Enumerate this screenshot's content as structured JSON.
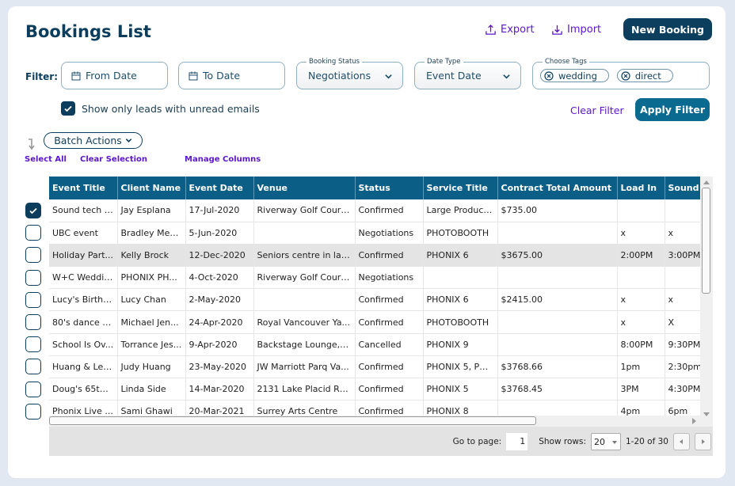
{
  "header": {
    "title": "Bookings List",
    "export_label": "Export",
    "import_label": "Import",
    "new_booking_label": "New Booking"
  },
  "filters": {
    "label": "Filter:",
    "from_date_placeholder": "From Date",
    "to_date_placeholder": "To Date",
    "booking_status": {
      "legend": "Booking Status",
      "value": "Negotiations"
    },
    "date_type": {
      "legend": "Date Type",
      "value": "Event Date"
    },
    "tags": {
      "legend": "Choose Tags",
      "selected": [
        "wedding",
        "direct"
      ]
    },
    "unread_checkbox": {
      "label": "Show only leads with unread emails",
      "checked": true
    },
    "clear_label": "Clear Filter",
    "apply_label": "Apply Filter"
  },
  "actions": {
    "batch_label": "Batch Actions",
    "select_all": "Select All",
    "clear_selection": "Clear Selection",
    "manage_columns": "Manage Columns"
  },
  "table": {
    "columns": [
      "Event Title",
      "Client Name",
      "Event Date",
      "Venue",
      "Status",
      "Service Title",
      "Contract Total Amount",
      "Load In",
      "Sound"
    ],
    "rows": [
      {
        "checked": true,
        "highlight": false,
        "cells": [
          "Sound tech -...",
          "Jay Esplana",
          "17-Jul-2020",
          "Riverway Golf Cours...",
          "Confirmed",
          "Large Product...",
          "$735.00",
          "",
          ""
        ]
      },
      {
        "checked": false,
        "highlight": false,
        "cells": [
          "UBC event",
          "Bradley Men...",
          "5-Jun-2020",
          "",
          "Negotiations",
          "PHOTOBOOTH",
          "",
          "x",
          "x"
        ]
      },
      {
        "checked": false,
        "highlight": true,
        "cells": [
          "Holiday Part...",
          "Kelly Brock",
          "12-Dec-2020",
          "Seniors centre in lan...",
          "Confirmed",
          "PHONIX 6",
          "$3675.00",
          "2:00PM",
          "3:00PM"
        ]
      },
      {
        "checked": false,
        "highlight": false,
        "cells": [
          "W+C Wedding",
          "PHONIX PH...",
          "4-Oct-2020",
          "Riverway Golf Cours...",
          "Negotiations",
          "",
          "",
          "",
          ""
        ]
      },
      {
        "checked": false,
        "highlight": false,
        "cells": [
          "Lucy's Birthd...",
          "Lucy Chan",
          "2-May-2020",
          "",
          "Confirmed",
          "PHONIX 6",
          "$2415.00",
          "x",
          "x"
        ]
      },
      {
        "checked": false,
        "highlight": false,
        "cells": [
          "80's dance p...",
          "Michael Jen...",
          "24-Apr-2020",
          "Royal Vancouver Ya...",
          "Confirmed",
          "PHOTOBOOTH",
          "",
          "x",
          "X"
        ]
      },
      {
        "checked": false,
        "highlight": false,
        "cells": [
          "School Is Ov...",
          "Torrance Jes...",
          "9-Apr-2020",
          "Backstage Lounge, J...",
          "Cancelled",
          "PHONIX 9",
          "",
          "8:00PM",
          "9:30PM"
        ]
      },
      {
        "checked": false,
        "highlight": false,
        "cells": [
          "Huang & Lee...",
          "Judy Huang",
          "23-May-2020",
          "JW Marriott Parq Va...",
          "Confirmed",
          "PHONIX 5, PH...",
          "$3768.66",
          "1pm",
          "2:30pm"
        ]
      },
      {
        "checked": false,
        "highlight": false,
        "cells": [
          "Doug's 65th ...",
          "Linda Side",
          "14-Mar-2020",
          "2131 Lake Placid Rd, ...",
          "Confirmed",
          "PHONIX 5",
          "$3768.45",
          "3PM",
          "4:30PM"
        ]
      },
      {
        "checked": false,
        "highlight": false,
        "cells": [
          "Phonix Live ...",
          "Sami Ghawi",
          "20-Mar-2021",
          "Surrey Arts Centre",
          "Confirmed",
          "PHONIX 8",
          "",
          "4pm",
          "6pm"
        ]
      }
    ]
  },
  "pagination": {
    "goto_label": "Go to page:",
    "current_page": "1",
    "rows_label": "Show rows:",
    "rows_value": "20",
    "range_text": "1-20 of 30"
  },
  "colors": {
    "brand_dark": "#0b3f5d",
    "header_bg": "#0b5f86",
    "apply_btn": "#0a6a8f",
    "link": "#5b16c9"
  }
}
